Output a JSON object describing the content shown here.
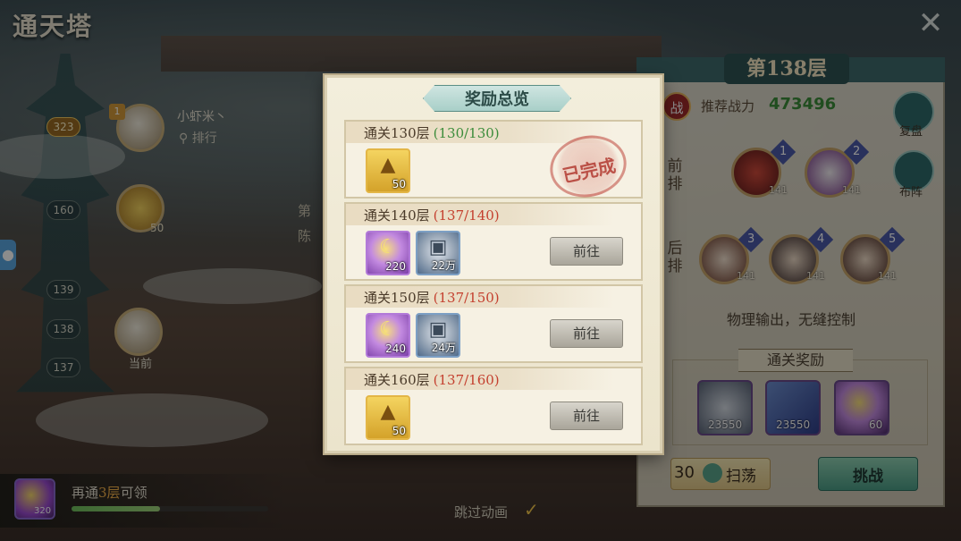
{
  "background": {
    "page_title": "通天塔",
    "close_icon": "close-icon",
    "floors": [
      "323",
      "160",
      "139",
      "138",
      "137"
    ],
    "player": {
      "name": "小虾米丶",
      "rank_link": "排行",
      "badge": "1"
    },
    "chest_count": "50",
    "current_label": "当前",
    "middle_text": "第\n陈",
    "bottom": {
      "icon_count": "320",
      "again_prefix": "再通",
      "again_number": "3层",
      "again_suffix": "可领",
      "progress": 0.45
    },
    "skip_animation": "跳过动画",
    "skip_check": "✓"
  },
  "right_panel": {
    "title": "第138层",
    "battle_badge": "战",
    "recommended_label": "推荐战力",
    "recommended_value": "473496",
    "replay_label": "复盘",
    "formation_label": "布阵",
    "front_row_label": "前排",
    "back_row_label": "后排",
    "front_heroes": [
      {
        "num": "1",
        "level": "141"
      },
      {
        "num": "2",
        "level": "141"
      }
    ],
    "back_heroes": [
      {
        "num": "3",
        "level": "141"
      },
      {
        "num": "4",
        "level": "141"
      },
      {
        "num": "5",
        "level": "141"
      }
    ],
    "description": "物理输出，无缝控制",
    "reward_title": "通关奖励",
    "rewards": [
      {
        "icon": "copper-coin-icon",
        "count": "23550"
      },
      {
        "icon": "scroll-icon",
        "count": "23550"
      },
      {
        "icon": "jade-icon",
        "count": "60"
      }
    ],
    "sweep_cost": "30",
    "sweep_label": "扫荡",
    "challenge_label": "挑战"
  },
  "modal": {
    "title": "奖励总览",
    "rows": [
      {
        "title": "通关130层",
        "progress": "(130/130)",
        "status": "done",
        "stamp": "已完成",
        "items": [
          {
            "type": "chest",
            "icon": "treasure-chest-icon",
            "count": "50"
          }
        ]
      },
      {
        "title": "通关140层",
        "progress": "(137/140)",
        "status": "todo",
        "button": "前往",
        "items": [
          {
            "type": "purple",
            "icon": "jade-icon",
            "count": "220"
          },
          {
            "type": "coin",
            "icon": "copper-coin-icon",
            "count": "22万"
          }
        ]
      },
      {
        "title": "通关150层",
        "progress": "(137/150)",
        "status": "todo",
        "button": "前往",
        "items": [
          {
            "type": "purple",
            "icon": "jade-icon",
            "count": "240"
          },
          {
            "type": "coin",
            "icon": "copper-coin-icon",
            "count": "24万"
          }
        ]
      },
      {
        "title": "通关160层",
        "progress": "(137/160)",
        "status": "todo",
        "button": "前往",
        "items": [
          {
            "type": "chest",
            "icon": "treasure-chest-icon",
            "count": "50"
          }
        ]
      }
    ]
  },
  "colors": {
    "done_green": "#3b8c3a",
    "todo_red": "#c43f2e",
    "header_teal": "#a8cfc8"
  }
}
